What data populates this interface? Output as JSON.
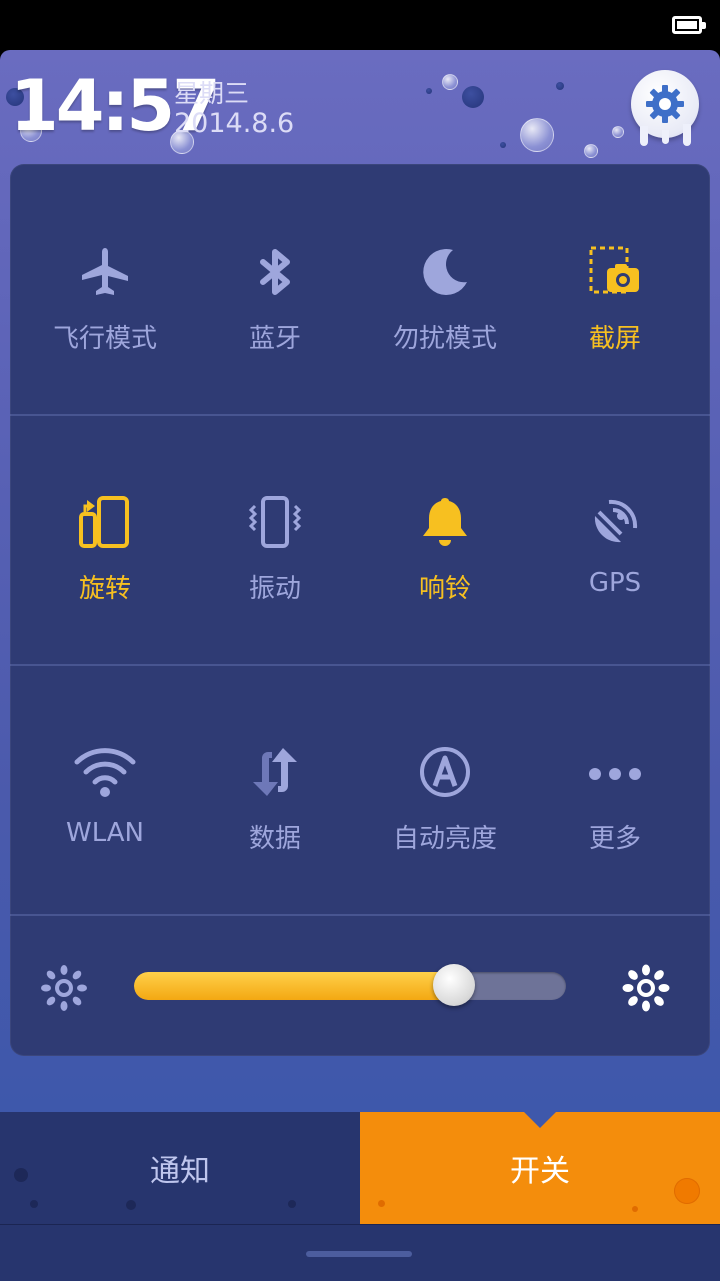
{
  "status_bar": {
    "battery_icon": "battery-full-icon"
  },
  "header": {
    "time": "14:57",
    "weekday": "星期三",
    "date": "2014.8.6",
    "settings_icon": "gear-icon"
  },
  "toggles": [
    {
      "label": "飞行模式",
      "icon": "airplane-icon",
      "active": false
    },
    {
      "label": "蓝牙",
      "icon": "bluetooth-icon",
      "active": false
    },
    {
      "label": "勿扰模式",
      "icon": "moon-icon",
      "active": false
    },
    {
      "label": "截屏",
      "icon": "screenshot-icon",
      "active": true
    },
    {
      "label": "旋转",
      "icon": "rotate-icon",
      "active": true
    },
    {
      "label": "振动",
      "icon": "vibrate-icon",
      "active": false
    },
    {
      "label": "响铃",
      "icon": "bell-icon",
      "active": true
    },
    {
      "label": "GPS",
      "icon": "gps-icon",
      "active": false
    },
    {
      "label": "WLAN",
      "icon": "wifi-icon",
      "active": false
    },
    {
      "label": "数据",
      "icon": "data-arrows-icon",
      "active": false
    },
    {
      "label": "自动亮度",
      "icon": "auto-brightness-icon",
      "active": false
    },
    {
      "label": "更多",
      "icon": "more-dots-icon",
      "active": false
    }
  ],
  "brightness": {
    "level": 0.74,
    "low_icon": "sun-low-icon",
    "high_icon": "sun-high-icon"
  },
  "tabs": {
    "notifications": "通知",
    "toggles": "开关",
    "selected": "toggles"
  },
  "colors": {
    "accent": "#f7c020",
    "tab_active": "#f48d0c",
    "panel": "#2f3b74",
    "inactive": "#9ea6dc"
  }
}
